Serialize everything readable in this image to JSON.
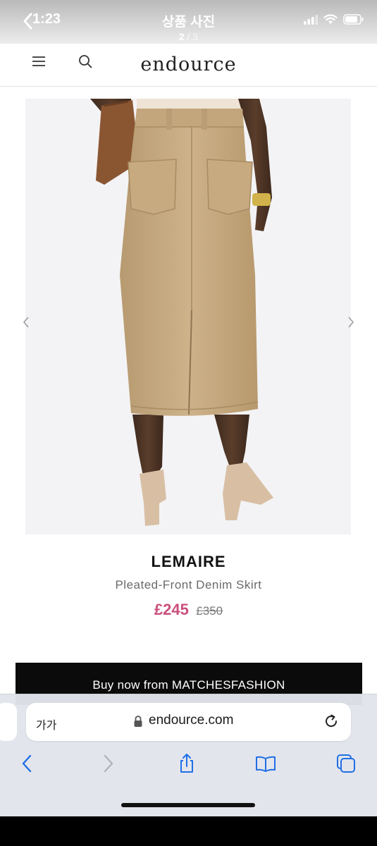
{
  "status_bar": {
    "time": "1:23"
  },
  "viewer": {
    "title": "상품 사진",
    "current": "2",
    "separator": " / ",
    "total": "3"
  },
  "site": {
    "logo": "endource"
  },
  "product": {
    "brand": "LEMAIRE",
    "name": "Pleated-Front Denim Skirt",
    "price_sale": "£245",
    "price_original": "£350"
  },
  "cta": {
    "label": "Buy now from MATCHESFASHION"
  },
  "browser": {
    "text_size_label": "가가",
    "url": "endource.com"
  },
  "colors": {
    "sale_price": "#c94f7c",
    "buy_bar": "#0b0b0b",
    "skirt": "#c9ad85"
  },
  "icons": [
    "back-chevron-icon",
    "signal-icon",
    "wifi-icon",
    "battery-icon",
    "menu-icon",
    "search-icon",
    "chevron-left-icon",
    "chevron-right-icon",
    "lock-icon",
    "reload-icon",
    "back-icon",
    "forward-icon",
    "share-icon",
    "bookmarks-icon",
    "tabs-icon"
  ]
}
